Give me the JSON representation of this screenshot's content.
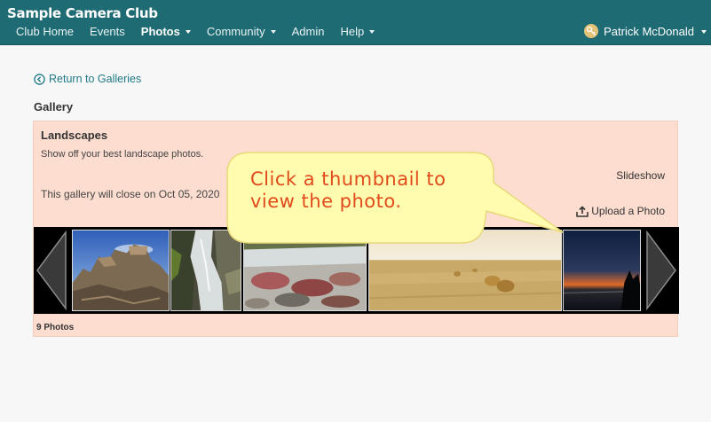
{
  "header": {
    "site_title": "Sample Camera Club",
    "nav": [
      {
        "label": "Club Home"
      },
      {
        "label": "Events"
      },
      {
        "label": "Photos"
      },
      {
        "label": "Community"
      },
      {
        "label": "Admin"
      },
      {
        "label": "Help"
      }
    ],
    "user_name": "Patrick McDonald"
  },
  "page": {
    "back_link": "Return to Galleries",
    "section_title": "Gallery"
  },
  "gallery": {
    "name": "Landscapes",
    "description": "Show off your best landscape photos.",
    "close_notice": "This gallery will close on Oct 05, 2020",
    "slideshow_label": "Slideshow",
    "upload_label": "Upload a Photo",
    "photo_count": "9 Photos"
  },
  "callout": {
    "text": "Click a thumbnail to view the photo."
  },
  "colors": {
    "header_bg": "#1f6b73",
    "panel_bg": "#fcddd0",
    "link": "#1f7a86",
    "callout_bg": "#fffcb0",
    "callout_text": "#e04a1c"
  }
}
